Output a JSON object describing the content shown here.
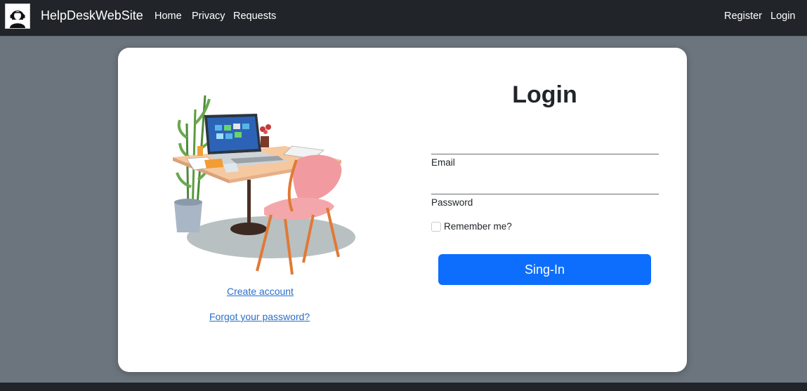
{
  "navbar": {
    "brand": "HelpDeskWebSite",
    "links": [
      {
        "label": "Home"
      },
      {
        "label": "Privacy"
      },
      {
        "label": "Requests"
      }
    ],
    "right_links": [
      {
        "label": "Register"
      },
      {
        "label": "Login"
      }
    ]
  },
  "login": {
    "title": "Login",
    "email_label": "Email",
    "email_value": "",
    "password_label": "Password",
    "password_value": "",
    "remember_label": "Remember me?",
    "remember_checked": false,
    "submit_label": "Sing-In"
  },
  "links": {
    "create_account": "Create account",
    "forgot_password": "Forgot your password?"
  },
  "colors": {
    "navbar_bg": "#212529",
    "page_bg": "#6c757d",
    "primary": "#0d6efd",
    "link": "#2a6fc9"
  },
  "icons": {
    "logo": "support-agent-icon",
    "illustration": "desk-laptop-chair-illustration"
  }
}
